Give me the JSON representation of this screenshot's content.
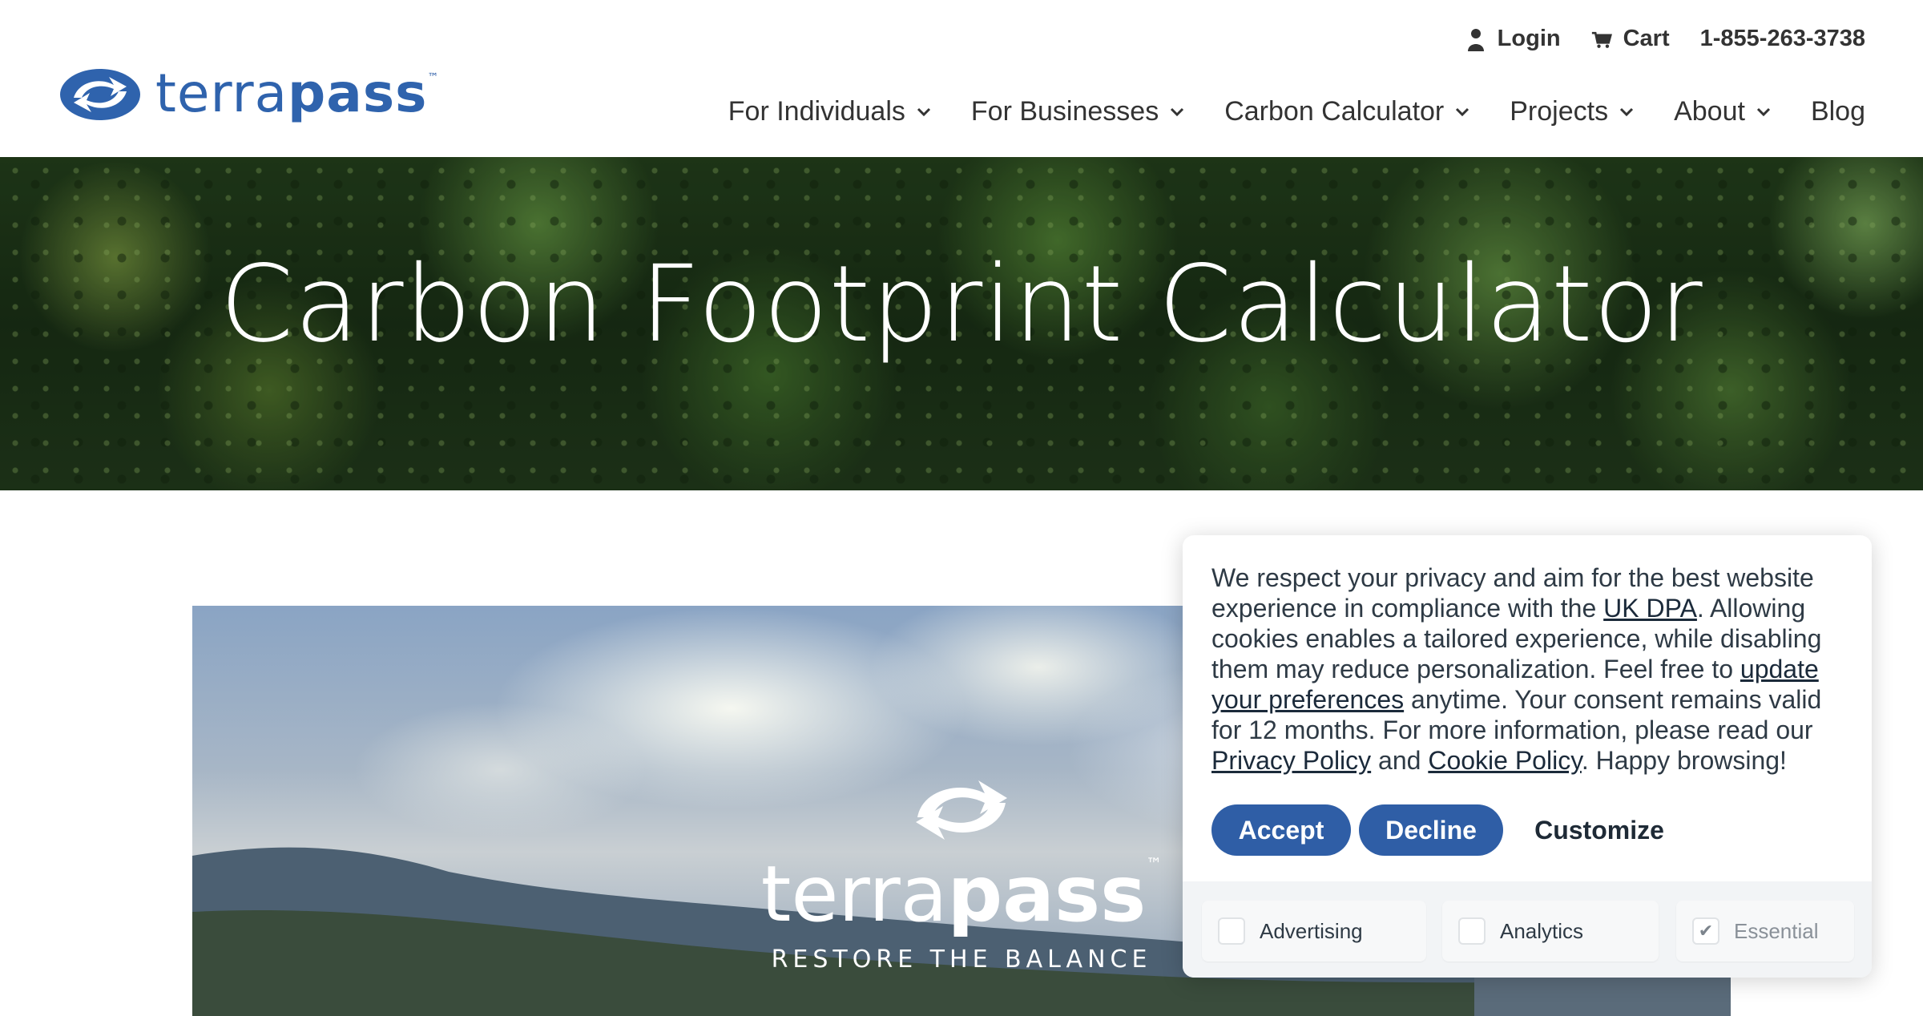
{
  "brand": {
    "logo_light": "terra",
    "logo_bold": "pass",
    "logo_tm": "™"
  },
  "utility": {
    "login": "Login",
    "cart": "Cart",
    "phone": "1-855-263-3738"
  },
  "nav": {
    "items": [
      {
        "label": "For Individuals",
        "dropdown": true
      },
      {
        "label": "For Businesses",
        "dropdown": true
      },
      {
        "label": "Carbon Calculator",
        "dropdown": true
      },
      {
        "label": "Projects",
        "dropdown": true
      },
      {
        "label": "About",
        "dropdown": true
      },
      {
        "label": "Blog",
        "dropdown": false
      }
    ]
  },
  "hero": {
    "title": "Carbon Footprint Calculator"
  },
  "banner": {
    "logo_light": "terra",
    "logo_bold": "pass",
    "logo_tm": "™",
    "tagline": "RESTORE THE BALANCE"
  },
  "cookie": {
    "text_1": "We respect your privacy and aim for the best website experience in compliance with the ",
    "link_dpa": "UK DPA",
    "text_2": ". Allowing cookies enables a tailored experience, while disabling them may reduce personalization. Feel free to ",
    "link_prefs": "update your preferences",
    "text_3": " anytime. Your consent remains valid for 12 months. For more information, please read our ",
    "link_privacy": "Privacy Policy",
    "text_4": " and ",
    "link_cookie": "Cookie Policy",
    "text_5": ". Happy browsing!",
    "accept": "Accept",
    "decline": "Decline",
    "customize": "Customize",
    "prefs": [
      {
        "label": "Advertising",
        "checked": false
      },
      {
        "label": "Analytics",
        "checked": false
      },
      {
        "label": "Essential",
        "checked": true,
        "check_glyph": "✔"
      }
    ]
  },
  "colors": {
    "brand_blue": "#2f5ea6",
    "text_dark": "#333333"
  }
}
